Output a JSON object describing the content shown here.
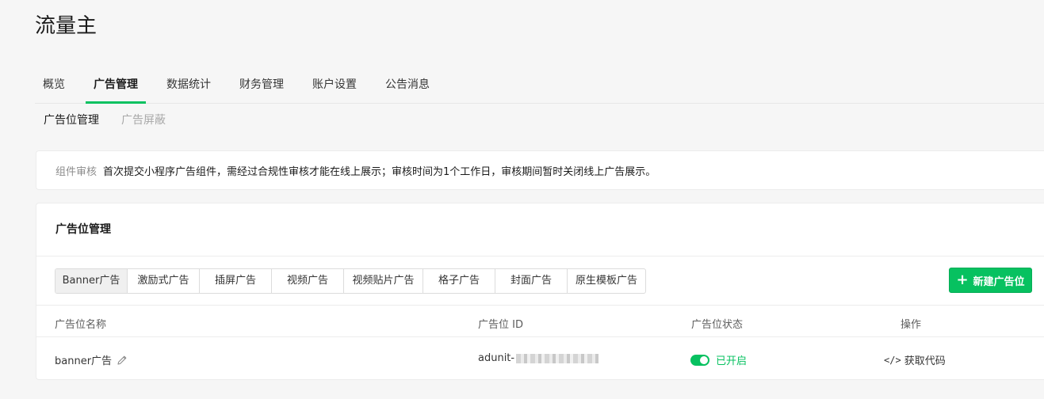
{
  "page": {
    "title": "流量主"
  },
  "main_nav": {
    "tabs": [
      {
        "label": "概览"
      },
      {
        "label": "广告管理",
        "active": true
      },
      {
        "label": "数据统计"
      },
      {
        "label": "财务管理"
      },
      {
        "label": "账户设置"
      },
      {
        "label": "公告消息"
      }
    ]
  },
  "sub_nav": {
    "items": [
      {
        "label": "广告位管理",
        "active": true
      },
      {
        "label": "广告屏蔽"
      }
    ]
  },
  "notice": {
    "label": "组件审核",
    "text": "首次提交小程序广告组件，需经过合规性审核才能在线上展示；审核时间为1个工作日，审核期间暂时关闭线上广告展示。"
  },
  "ad_management": {
    "title": "广告位管理",
    "ad_types": [
      {
        "label": "Banner广告",
        "active": true
      },
      {
        "label": "激励式广告"
      },
      {
        "label": "插屏广告"
      },
      {
        "label": "视频广告"
      },
      {
        "label": "视频贴片广告"
      },
      {
        "label": "格子广告"
      },
      {
        "label": "封面广告"
      },
      {
        "label": "原生模板广告"
      }
    ],
    "new_button_label": "新建广告位",
    "table": {
      "headers": {
        "name": "广告位名称",
        "id": "广告位 ID",
        "status": "广告位状态",
        "action": "操作"
      },
      "rows": [
        {
          "name": "banner广告",
          "id_prefix": "adunit-",
          "status": "已开启",
          "action": "获取代码"
        }
      ]
    }
  },
  "colors": {
    "accent": "#07c160",
    "background": "#f6f6f6"
  },
  "icons": {
    "plus": "plus-icon",
    "edit": "pencil-icon",
    "code": "code-icon",
    "toggle": "toggle-on"
  }
}
